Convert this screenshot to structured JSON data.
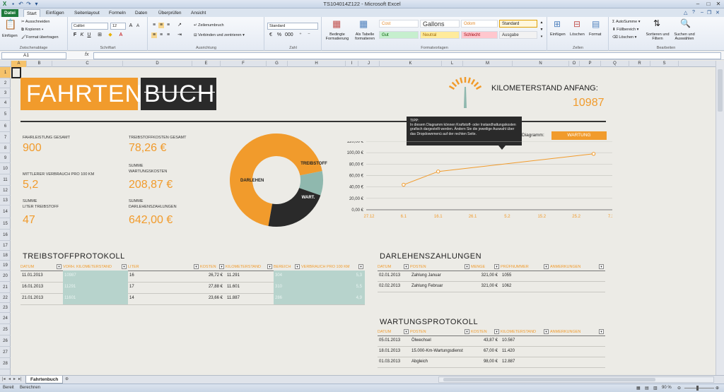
{
  "window": {
    "title": "TS104014Z122 - Microsoft Excel"
  },
  "tabs": [
    "Datei",
    "Start",
    "Einfügen",
    "Seitenlayout",
    "Formeln",
    "Daten",
    "Überprüfen",
    "Ansicht"
  ],
  "ribbon": {
    "clipboard": {
      "paste": "Einfügen",
      "cut": "Ausschneiden",
      "copy": "Kopieren",
      "format_painter": "Format übertragen",
      "label": "Zwischenablage"
    },
    "font": {
      "name": "Calibri",
      "size": "12",
      "label": "Schriftart"
    },
    "alignment": {
      "wrap": "Zeilenumbruch",
      "merge": "Verbinden und zentrieren",
      "label": "Ausrichtung"
    },
    "number": {
      "format": "Standard",
      "label": "Zahl"
    },
    "styles": {
      "cond_format": "Bedingte Formatierung",
      "as_table": "Als Tabelle formatieren",
      "cells": [
        {
          "label": "Cost",
          "bg": "#ffffff",
          "fg": "#e38b2d"
        },
        {
          "label": "Gallons",
          "bg": "#ffffff",
          "fg": "#333333"
        },
        {
          "label": "Odom",
          "bg": "#ffffff",
          "fg": "#e38b2d"
        },
        {
          "label": "Standard",
          "bg": "#fff7dd",
          "fg": "#222222"
        },
        {
          "label": "Gut",
          "bg": "#c6efce",
          "fg": "#006100"
        },
        {
          "label": "Neutral",
          "bg": "#ffeb9c",
          "fg": "#9c6500"
        },
        {
          "label": "Schlecht",
          "bg": "#ffc7ce",
          "fg": "#9c0006"
        },
        {
          "label": "Ausgabe",
          "bg": "#f2f2f2",
          "fg": "#333333"
        }
      ],
      "label": "Formatvorlagen"
    },
    "cells_group": {
      "insert": "Einfügen",
      "delete": "Löschen",
      "format": "Format",
      "label": "Zellen"
    },
    "editing": {
      "autosum": "AutoSumme",
      "fill": "Füllbereich",
      "clear": "Löschen",
      "sort": "Sortieren und Filtern",
      "find": "Suchen und Auswählen",
      "label": "Bearbeiten"
    }
  },
  "formula": {
    "namebox": "A1",
    "fx": "fx"
  },
  "columns": [
    "A",
    "B",
    "C",
    "D",
    "E",
    "F",
    "G",
    "H",
    "I",
    "J",
    "K",
    "L",
    "M",
    "N",
    "O",
    "P",
    "Q",
    "R",
    "S"
  ],
  "rows": [
    "1",
    "2",
    "3",
    "4",
    "5",
    "6",
    "7",
    "8",
    "9",
    "10",
    "11",
    "12",
    "13",
    "14",
    "15",
    "16",
    "17",
    "18",
    "19",
    "20",
    "21",
    "22",
    "23",
    "24",
    "25",
    "26",
    "27",
    "28"
  ],
  "header": {
    "logo_left": "FAHRTEN",
    "logo_right": "BUCH",
    "odometer_label": "KILOMETERSTAND ANFANG:",
    "odometer_value": "10987"
  },
  "kpis": [
    {
      "label": "FAHRLEISTUNG GESAMT",
      "value": "900"
    },
    {
      "label": "MITTLERER VERBRAUCH PRO 100 KM",
      "value": "5,2"
    },
    {
      "label1": "SUMME",
      "label2": "LITER TREIBSTOFF",
      "value": "47"
    },
    {
      "label": "TREIBSTOFFKOSTEN GESAMT",
      "value": "78,26 €"
    },
    {
      "label1": "SUMME",
      "label2": "WARTUNGSKOSTEN",
      "value": "208,87 €"
    },
    {
      "label1": "SUMME",
      "label2": "DARLEHENSZAHLUNGEN",
      "value": "642,00 €"
    }
  ],
  "donut": {
    "segments": [
      {
        "name": "DARLEHEN",
        "value": 642.0,
        "color": "#f19b2c"
      },
      {
        "name": "TREIBSTOFF",
        "value": 78.26,
        "color": "#8fb8ae"
      },
      {
        "name": "WART.",
        "value": 208.87,
        "color": "#2a2a2a"
      }
    ]
  },
  "tooltip": {
    "title": "TIPP:",
    "text": "In diesem Diagramm können Kraftstoff- oder Instandhaltungskosten grafisch dargestellt werden. Ändern Sie die jeweilige Auswahl über das Dropdownmenü auf der rechten Seite."
  },
  "diagram": {
    "label": "Diagramm:",
    "value": "WARTUNG"
  },
  "chart_data": {
    "type": "line",
    "categories": [
      "27.12",
      "6.1",
      "16.1",
      "26.1",
      "5.2",
      "15.2",
      "25.2",
      "7.3"
    ],
    "points": [
      {
        "x": "6.1",
        "y": 43.87
      },
      {
        "x": "16.1",
        "y": 67.0
      },
      {
        "x": "2.3",
        "y": 98.0
      }
    ],
    "y_ticks": [
      "120,00 €",
      "100,00 €",
      "80,00 €",
      "60,00 €",
      "40,00 €",
      "20,00 €",
      "0,00 €"
    ],
    "ylim": [
      0,
      120
    ],
    "color": "#f19b2c"
  },
  "fuel_log": {
    "title": "TREIBSTOFFPROTOKOLL",
    "headers": [
      "DATUM",
      "VORH. KILOMETERSTAND",
      "LITER",
      "KOSTEN",
      "KILOMETERSTAND",
      "BEREICH",
      "VERBRAUCH PRO 100 KM"
    ],
    "rows": [
      [
        "11.01.2013",
        "10987",
        "16",
        "26,72 €",
        "11.291",
        "304",
        "5,3"
      ],
      [
        "16.01.2013",
        "11291",
        "17",
        "27,88 €",
        "11.601",
        "310",
        "5,5"
      ],
      [
        "21.01.2013",
        "11601",
        "14",
        "23,66 €",
        "11.887",
        "286",
        "4,9"
      ]
    ]
  },
  "loan": {
    "title": "DARLEHENSZAHLUNGEN",
    "headers": [
      "DATUM",
      "POSTEN",
      "MENGE",
      "PRÜFNUMMER",
      "ANMERKUNGEN"
    ],
    "rows": [
      [
        "02.01.2013",
        "Zahlung Januar",
        "321,00 €",
        "1055",
        ""
      ],
      [
        "02.02.2013",
        "Zahlung Februar",
        "321,00 €",
        "1062",
        ""
      ]
    ]
  },
  "maintenance": {
    "title": "WARTUNGSPROTOKOLL",
    "headers": [
      "DATUM",
      "POSTEN",
      "KOSTEN",
      "KILOMETERSTAND",
      "ANMERKUNGEN"
    ],
    "rows": [
      [
        "05.01.2013",
        "Ölwechsel",
        "43,87 €",
        "10.567",
        ""
      ],
      [
        "18.01.2013",
        "15.000-Km-Wartungsdienst",
        "67,00 €",
        "11.420",
        ""
      ],
      [
        "01.03.2013",
        "Abgleich",
        "98,00 €",
        "12.887",
        ""
      ]
    ]
  },
  "sheet_tab": "Fahrtenbuch",
  "status": {
    "ready": "Bereit",
    "calc": "Berechnen",
    "zoom": "90 %"
  }
}
